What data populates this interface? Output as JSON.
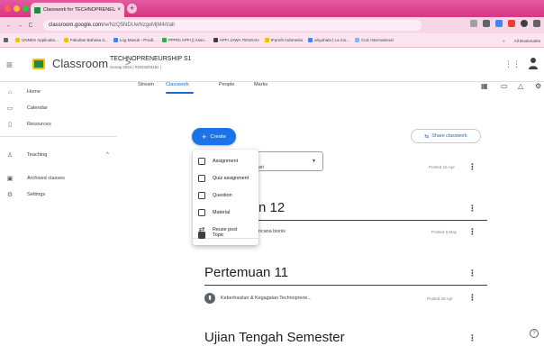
{
  "browser": {
    "tab_title": "Classwork for TECHNOPRENEU",
    "tab_close": "×",
    "new_tab": "+",
    "url_domain": "classroom.google.com",
    "url_path": "/w/NzQ5NDUwNzgxMjM4/t/all",
    "bookmarks": [
      "UNNES Applicatio...",
      "Fakultas Bahasa d...",
      "Log Masuk › Prodi...",
      "PPPDI APFI || Asso...",
      "APFI JAWA TENGAH",
      "IFprofs Indonesia",
      "ariyahala | La mo...",
      "CLE International"
    ],
    "bookmarks_more": "»",
    "all_bookmarks": "All Bookmarks"
  },
  "header": {
    "app_name": "Classroom",
    "separator": ">",
    "course_name": "TECHNOPRENEURSHIP S1",
    "course_sub": "Genap 2024 | #2024203181 |"
  },
  "sidebar": {
    "items": [
      {
        "label": "Home",
        "icon": "home-icon"
      },
      {
        "label": "Calendar",
        "icon": "calendar-icon"
      },
      {
        "label": "Resources",
        "icon": "resources-icon"
      },
      {
        "label": "Teaching",
        "icon": "teaching-icon"
      },
      {
        "label": "Archived classes",
        "icon": "archive-icon"
      },
      {
        "label": "Settings",
        "icon": "settings-icon"
      }
    ],
    "teaching_caret": "^"
  },
  "tabs": [
    {
      "label": "Stream"
    },
    {
      "label": "Classwork",
      "active": true
    },
    {
      "label": "People"
    },
    {
      "label": "Marks"
    }
  ],
  "actions": {
    "create_label": "Create",
    "share_label": "Share classwork"
  },
  "create_menu": [
    {
      "label": "Assignment",
      "icon": "assignment-icon"
    },
    {
      "label": "Quiz assignment",
      "icon": "quiz-icon"
    },
    {
      "label": "Question",
      "icon": "question-icon"
    },
    {
      "label": "Material",
      "icon": "material-icon"
    },
    {
      "label": "Reuse post",
      "icon": "reuse-icon"
    },
    {
      "label": "Topic",
      "icon": "topic-icon"
    }
  ],
  "stream": {
    "row1_text": "ari",
    "row1_posted": "Posted 15 Apr",
    "topic1_title": "n 12",
    "row2_text": "ncana bisnis",
    "row2_posted": "Posted 6 May",
    "topic2_title": "Pertemuan 11",
    "row3_text": "Keberhasilan & Kegagalan Technoprene...",
    "row3_posted": "Posted 29 Apr",
    "topic3_title": "Ujian Tengah Semester"
  },
  "help_glyph": "?",
  "colors": {
    "accent": "#1a73e8",
    "browser_pink": "#dc3b8c",
    "logo_green": "#1e8e3e"
  }
}
